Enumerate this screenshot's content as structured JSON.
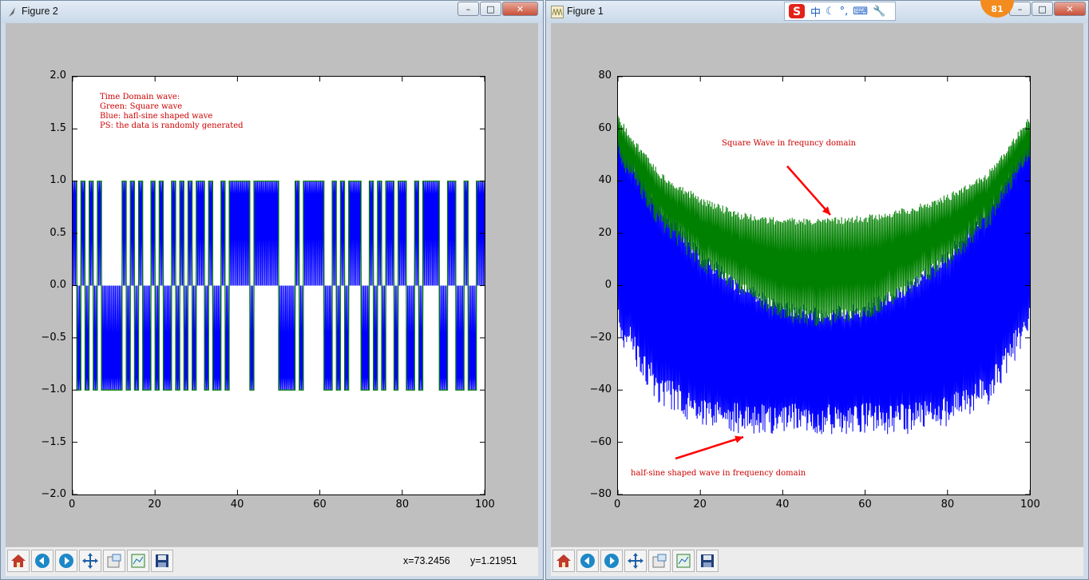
{
  "figure2": {
    "title": "Figure 2",
    "y_ticks": [
      "2.0",
      "1.5",
      "1.0",
      "0.5",
      "0.0",
      "−0.5",
      "−1.0",
      "−1.5",
      "−2.0"
    ],
    "x_ticks": [
      "0",
      "20",
      "40",
      "60",
      "80",
      "100"
    ],
    "annotation": [
      "Time Domain wave:",
      "Green:  Square wave",
      "Blue: hafl-sine shaped wave",
      "PS: the data is randomly generated"
    ],
    "coords": {
      "x": "x=73.2456",
      "y": "y=1.21951"
    }
  },
  "figure1": {
    "title": "Figure 1",
    "y_ticks": [
      "80",
      "60",
      "40",
      "20",
      "0",
      "−20",
      "−40",
      "−60",
      "−80"
    ],
    "x_ticks": [
      "0",
      "20",
      "40",
      "60",
      "80",
      "100"
    ],
    "annotation_square": "Square Wave in frequncy domain",
    "annotation_halfsine": "half-sine shaped wave in frequency domain"
  },
  "ime": {
    "label_cn": "中"
  },
  "badge": {
    "value": "81"
  },
  "toolbar_icons": [
    "home-icon",
    "back-icon",
    "forward-icon",
    "pan-icon",
    "zoom-icon",
    "subplots-icon",
    "save-icon"
  ],
  "colors": {
    "square": "#008000",
    "halfsine": "#0000ff",
    "annotation": "#cc0000",
    "arrow": "#ff0000",
    "canvas_bg": "#bfbfbf"
  },
  "chart_data": [
    {
      "type": "line",
      "title": "",
      "xlabel": "",
      "ylabel": "",
      "xlim": [
        0,
        100
      ],
      "ylim": [
        -2.0,
        2.0
      ],
      "grid": false,
      "series": [
        {
          "name": "Green:  Square wave",
          "color": "#008000",
          "bits": [
            1,
            0,
            1,
            0,
            1,
            0,
            1,
            0,
            0,
            0,
            0,
            0,
            1,
            0,
            1,
            0,
            1,
            0,
            0,
            1,
            0,
            1,
            0,
            0,
            1,
            0,
            1,
            0,
            1,
            0,
            1,
            1,
            0,
            1,
            0,
            0,
            1,
            0,
            1,
            1,
            1,
            1,
            1,
            0,
            1,
            1,
            1,
            1,
            1,
            1,
            0,
            0,
            0,
            0,
            1,
            0,
            1,
            1,
            1,
            1,
            1,
            0,
            0,
            1,
            0,
            1,
            0,
            1,
            1,
            1,
            0,
            0,
            1,
            0,
            1,
            0,
            1,
            1,
            0,
            1,
            1,
            0,
            0,
            1,
            0,
            1,
            1,
            1,
            1,
            0,
            0,
            1,
            1,
            0,
            0,
            1,
            0,
            0,
            1,
            1
          ]
        },
        {
          "name": "Blue: hafl-sine shaped wave",
          "color": "#0000ff",
          "note": "half-sine pulses of amplitude ±1 following the same bits"
        }
      ]
    },
    {
      "type": "line",
      "title": "",
      "xlabel": "",
      "ylabel": "",
      "xlim": [
        0,
        100
      ],
      "ylim": [
        -80,
        80
      ],
      "grid": false,
      "series": [
        {
          "name": "Square Wave in frequncy domain",
          "color": "#008000",
          "envelope_top": [
            65,
            44,
            34,
            28,
            26,
            26,
            27,
            30,
            35,
            44,
            65
          ],
          "envelope_bottom": [
            48,
            22,
            6,
            -4,
            -14,
            -16,
            -14,
            -4,
            6,
            22,
            48
          ]
        },
        {
          "name": "half-sine shaped wave in frequency domain",
          "color": "#0000ff",
          "envelope_top": [
            60,
            34,
            14,
            2,
            -6,
            -8,
            -6,
            2,
            14,
            34,
            60
          ],
          "envelope_bottom": [
            -20,
            -46,
            -54,
            -57,
            -57,
            -57,
            -57,
            -57,
            -54,
            -46,
            -20
          ]
        }
      ]
    }
  ]
}
